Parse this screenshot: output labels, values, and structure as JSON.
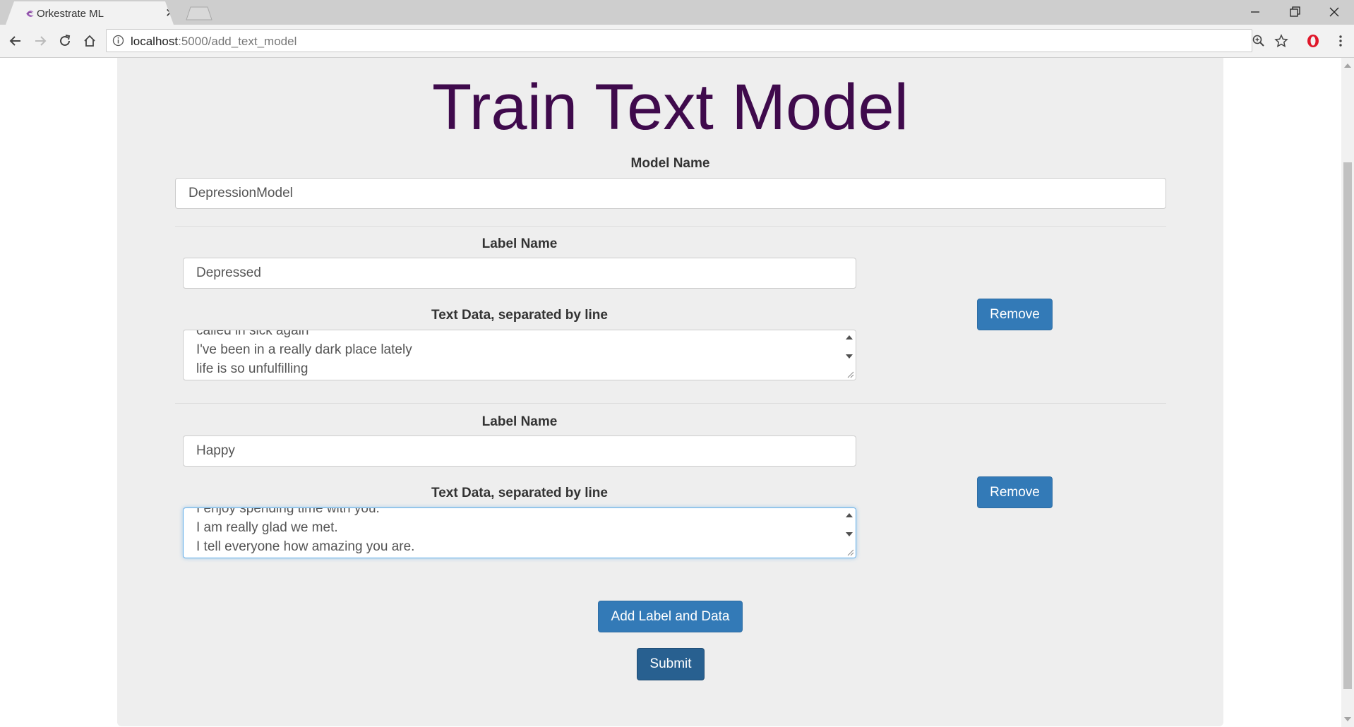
{
  "browser": {
    "tab_title": "Orkestrate ML",
    "url_host": "localhost",
    "url_path": ":5000/add_text_model"
  },
  "page": {
    "title": "Train Text Model",
    "model_name_label": "Model Name",
    "model_name_value": "DepressionModel",
    "groups": [
      {
        "label_name_label": "Label Name",
        "label_name_value": "Depressed",
        "text_data_label": "Text Data, separated by line",
        "text_lines": [
          "called in sick again",
          "I've been in a really dark place lately",
          "life is so unfulfilling"
        ],
        "remove_label": "Remove"
      },
      {
        "label_name_label": "Label Name",
        "label_name_value": "Happy",
        "text_data_label": "Text Data, separated by line",
        "text_lines": [
          "I enjoy spending time with you.",
          "I am really glad we met.",
          "I tell everyone how amazing you are."
        ],
        "remove_label": "Remove"
      }
    ],
    "add_button_label": "Add Label and Data",
    "submit_button_label": "Submit"
  },
  "colors": {
    "title": "#3f0a4c",
    "button_primary": "#337ab7",
    "button_active": "#286090",
    "panel": "#eeeeee"
  }
}
